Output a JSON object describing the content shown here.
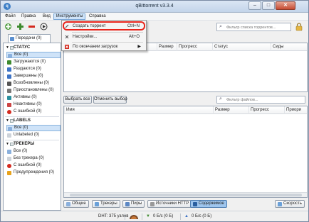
{
  "window": {
    "title": "qBittorrent v3.3.4"
  },
  "menubar": {
    "items": [
      "Файл",
      "Правка",
      "Вид",
      "Инструменты",
      "Справка"
    ]
  },
  "toolbar": {
    "search_placeholder": "Фильтр списка торрентов..."
  },
  "tools_menu": {
    "items": [
      {
        "label": "Создать торрент",
        "shortcut": "Ctrl+N"
      },
      {
        "label": "Настройки...",
        "shortcut": "Alt+O"
      },
      {
        "label": "По окончании загрузок",
        "shortcut": ""
      }
    ]
  },
  "left_tab": {
    "label": "Передачи (0)"
  },
  "sidebar": {
    "status_header": "СТАТУС",
    "status_items": [
      "Все (0)",
      "Загружаются (0)",
      "Раздаются (0)",
      "Завершены (0)",
      "Возобновлены (0)",
      "Приостановлены (0)",
      "Активны (0)",
      "Неактивны (0)",
      "С ошибкой (0)"
    ],
    "labels_header": "LABELS",
    "labels_items": [
      "Все (0)",
      "Unlabeled (0)"
    ],
    "trackers_header": "ТРЕКЕРЫ",
    "trackers_items": [
      "Все (0)",
      "Без трекера (0)",
      "С ошибкой (0)",
      "Предупреждения (0)"
    ]
  },
  "torrent_table": {
    "columns": [
      "Размер",
      "Прогресс",
      "Статус",
      "Сиды"
    ]
  },
  "files_toolbar": {
    "select_all": "Выбрать все",
    "deselect": "Отменить выбор",
    "filter_placeholder": "Фильтр файлов..."
  },
  "files_table": {
    "columns": [
      "Имя",
      "Размер",
      "Прогресс",
      "Приори"
    ]
  },
  "bottom_tabs": [
    "Общие",
    "Трекеры",
    "Пиры",
    "Источники HTTP",
    "Содержимое",
    "Скорость"
  ],
  "status_bar": {
    "dht": "DHT: 375 узлов",
    "down": "0 Б/с (0 Б)",
    "up": "0 Б/с (0 Б)"
  },
  "colors": {
    "highlight_ring": "#e8241b",
    "selection": "#cfe3f8",
    "active_tab": "#9fc6ee"
  }
}
